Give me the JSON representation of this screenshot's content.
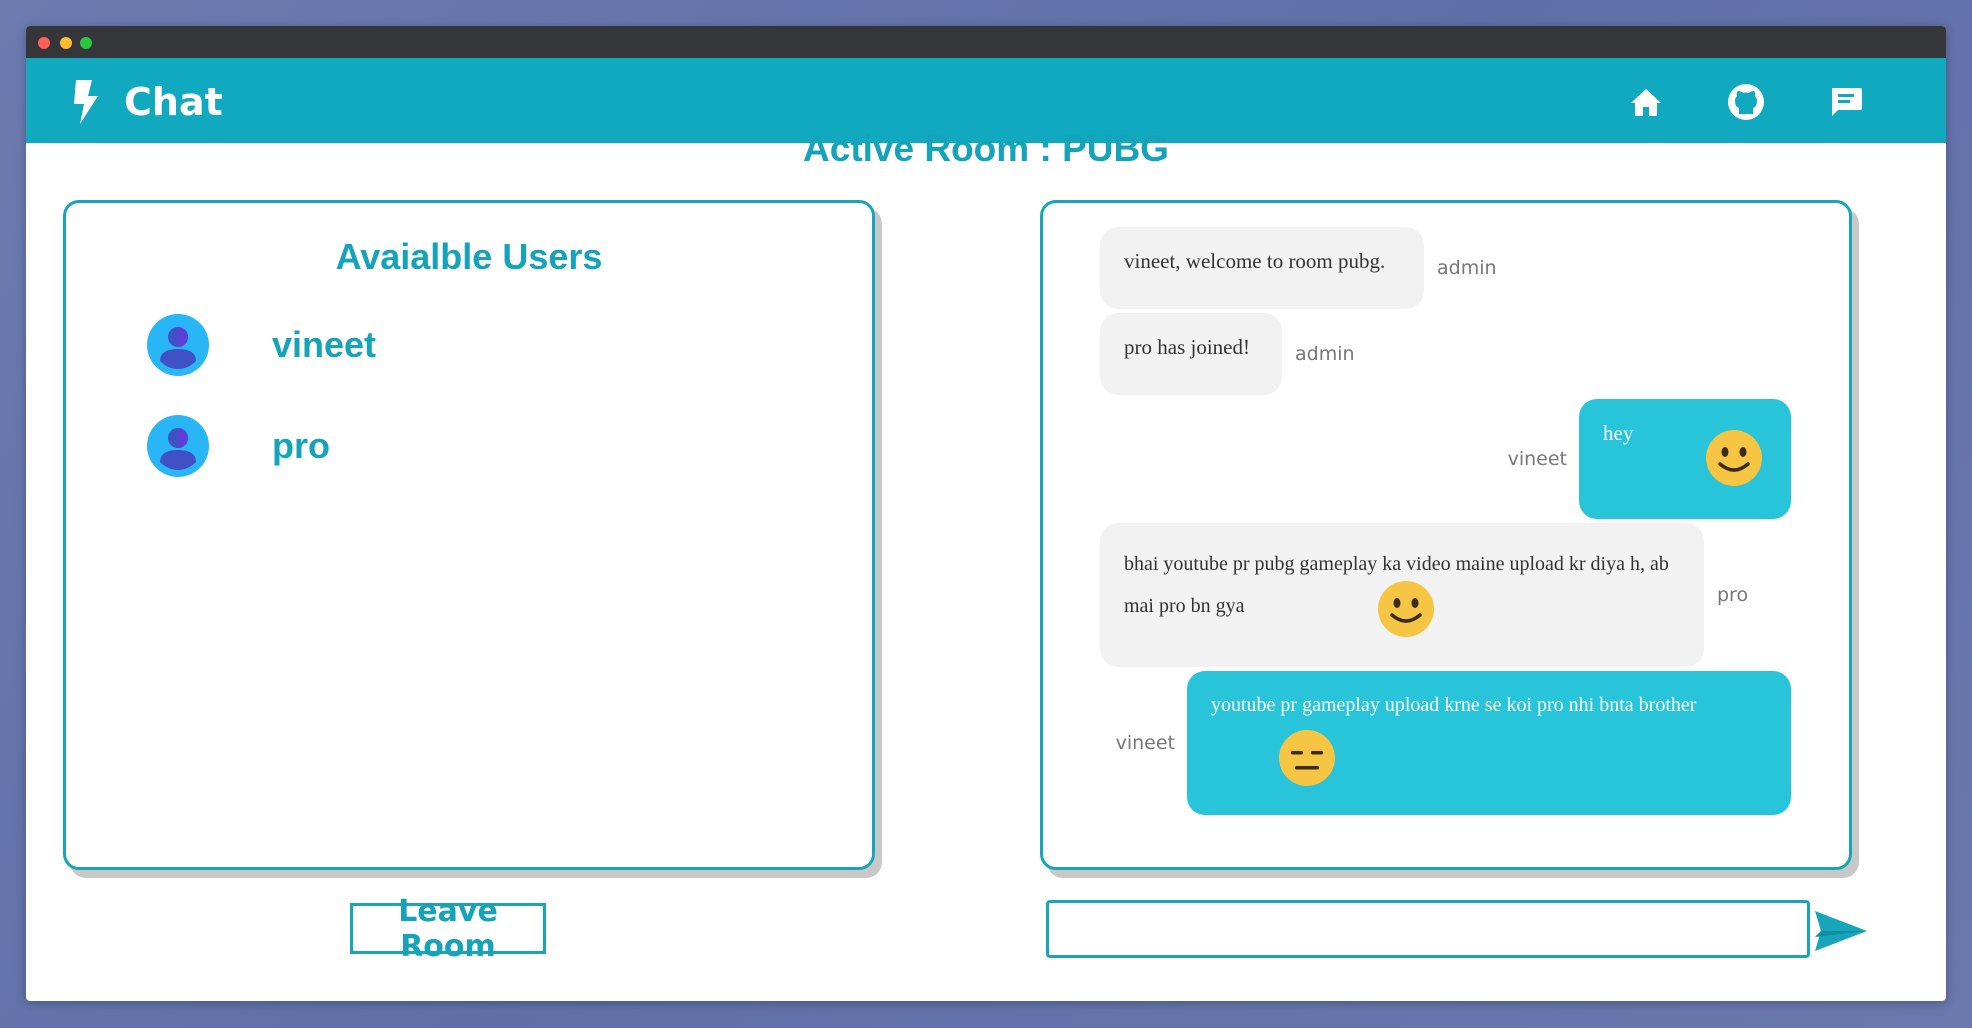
{
  "app": {
    "title": "Chat"
  },
  "nav": {
    "icons": [
      "home-icon",
      "github-icon",
      "chat-icon"
    ]
  },
  "room": {
    "label": "Active Room : PUBG"
  },
  "users": {
    "heading": "Avaialble Users",
    "list": [
      {
        "name": "vineet"
      },
      {
        "name": "pro"
      }
    ]
  },
  "messages": [
    {
      "text": "vineet, welcome to room pubg.",
      "sender": "admin",
      "own": false
    },
    {
      "text": "pro has joined!",
      "sender": "admin",
      "own": false
    },
    {
      "text": "hey",
      "sender": "vineet",
      "own": true,
      "emoji": "smile"
    },
    {
      "text": "bhai youtube pr pubg gameplay ka video maine upload kr diya h, ab mai pro bn gya",
      "sender": "pro",
      "own": false,
      "emoji": "smile"
    },
    {
      "text": "youtube pr gameplay upload krne se koi pro nhi bnta brother",
      "sender": "vineet",
      "own": true,
      "emoji": "expressionless"
    }
  ],
  "actions": {
    "leave_label": "Leave Room"
  },
  "input": {
    "placeholder": "",
    "value": ""
  },
  "colors": {
    "accent": "#10a9bf",
    "own_bubble": "#27c4da",
    "other_bubble": "#f2f2f2"
  }
}
